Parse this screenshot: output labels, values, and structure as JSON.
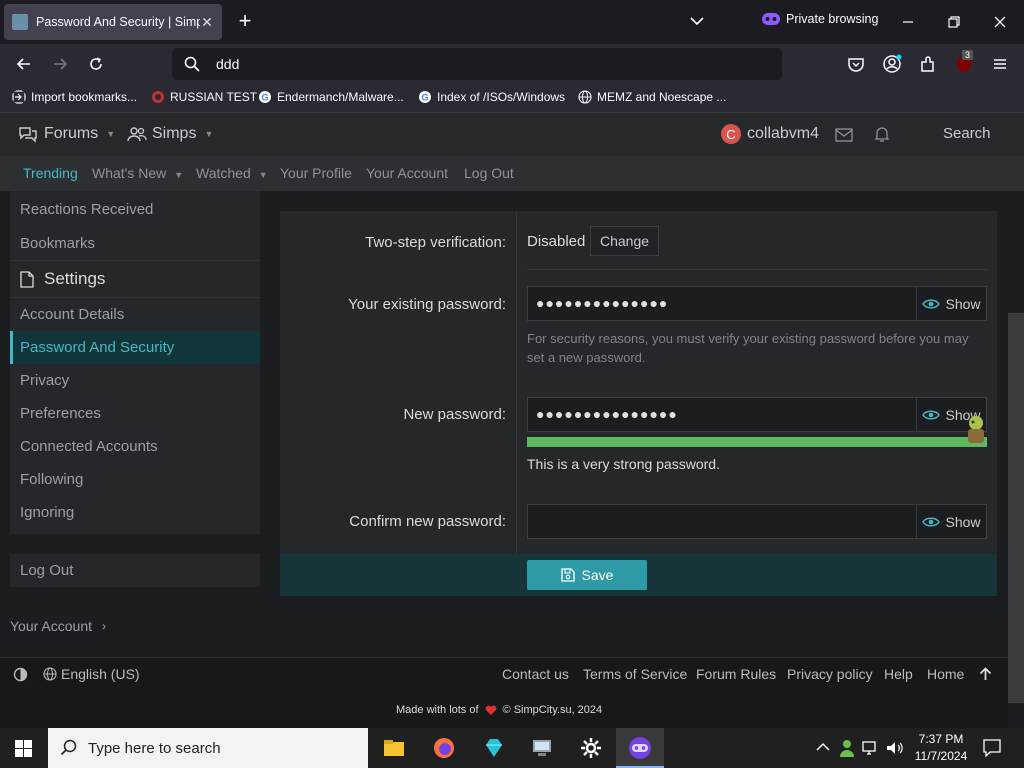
{
  "browser": {
    "tab_title": "Password And Security | SimpCi",
    "private_label": "Private browsing",
    "url_query": "ddd",
    "extension_badge": "3",
    "bookmarks": [
      "Import bookmarks...",
      "RUSSIAN TEST",
      "Endermanch/Malware...",
      "Index of /ISOs/Windows",
      "MEMZ and Noescape ..."
    ]
  },
  "header": {
    "forums_label": "Forums",
    "simps_label": "Simps",
    "user_initial": "C",
    "username": "collabvm4",
    "search_label": "Search"
  },
  "subnav": [
    "Trending",
    "What's New",
    "Watched",
    "Your Profile",
    "Your Account",
    "Log Out"
  ],
  "sidebar": {
    "top_items": [
      "Reactions Received",
      "Bookmarks"
    ],
    "settings_heading": "Settings",
    "items": [
      "Account Details",
      "Password And Security",
      "Privacy",
      "Preferences",
      "Connected Accounts",
      "Following",
      "Ignoring"
    ],
    "logout": "Log Out"
  },
  "form": {
    "two_step_label": "Two-step verification:",
    "two_step_status": "Disabled",
    "change_label": "Change",
    "existing_label": "Your existing password:",
    "existing_value": "●●●●●●●●●●●●●●",
    "show_label": "Show",
    "existing_hint": "For security reasons, you must verify your existing password before you may set a new password.",
    "new_label": "New password:",
    "new_value": "●●●●●●●●●●●●●●●",
    "strength_text": "This is a very strong password.",
    "strength_fraction": 1.0,
    "confirm_label": "Confirm new password:",
    "save_label": "Save"
  },
  "breadcrumb": "Your Account",
  "footer": {
    "language": "English (US)",
    "links": [
      "Contact us",
      "Terms of Service",
      "Forum Rules",
      "Privacy policy",
      "Help",
      "Home"
    ],
    "made_prefix": "Made with lots of",
    "made_suffix": "© SimpCity.su, 2024"
  },
  "taskbar": {
    "search_placeholder": "Type here to search",
    "time": "7:37 PM",
    "date": "11/7/2024"
  },
  "colors": {
    "accent": "#47b7c4",
    "strength_bar": "#5cb85c",
    "save_button": "#2d9aa6"
  }
}
